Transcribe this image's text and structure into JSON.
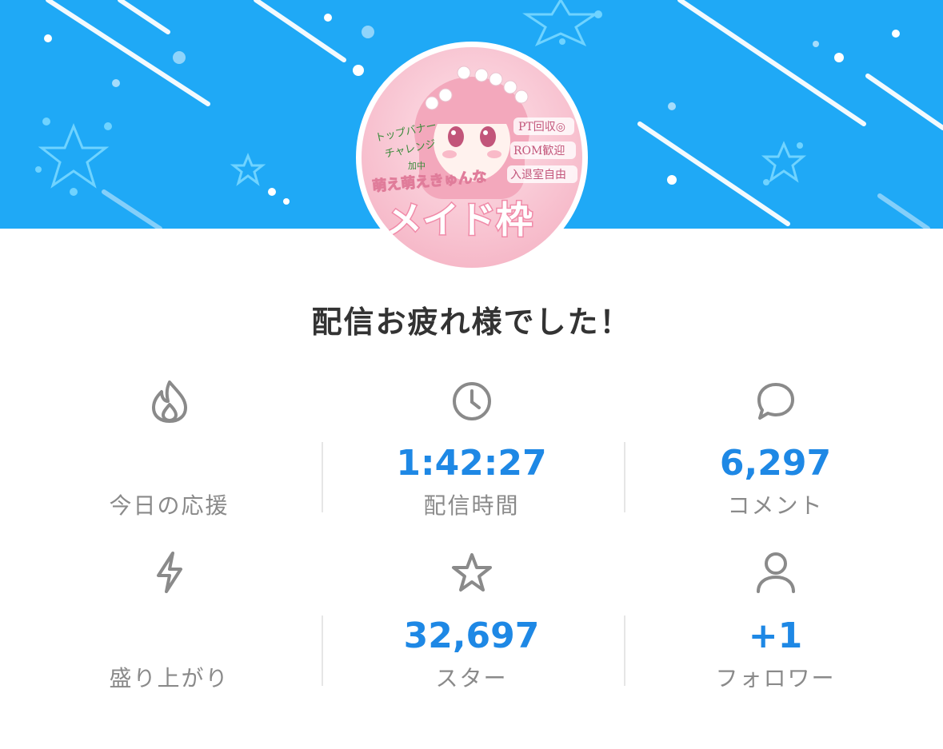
{
  "colors": {
    "banner": "#1fa9f6",
    "value": "#1e88e5",
    "label": "#8a8a8a",
    "title": "#333333"
  },
  "avatar": {
    "icon": "avatar-image",
    "texts": [
      "トップバナー",
      "チャレンジ",
      "加中",
      "PT回収◎",
      "ROM歓迎",
      "入退室自由",
      "萌え萌えきゅんな",
      "メイド枠"
    ]
  },
  "title": "配信お疲れ様でした！",
  "stats": [
    {
      "icon": "flame-icon",
      "value": "",
      "label": "今日の応援"
    },
    {
      "icon": "clock-icon",
      "value": "1:42:27",
      "label": "配信時間"
    },
    {
      "icon": "comment-bubble-icon",
      "value": "6,297",
      "label": "コメント"
    },
    {
      "icon": "lightning-icon",
      "value": "",
      "label": "盛り上がり"
    },
    {
      "icon": "star-icon",
      "value": "32,697",
      "label": "スター"
    },
    {
      "icon": "person-icon",
      "value": "+1",
      "label": "フォロワー"
    }
  ]
}
